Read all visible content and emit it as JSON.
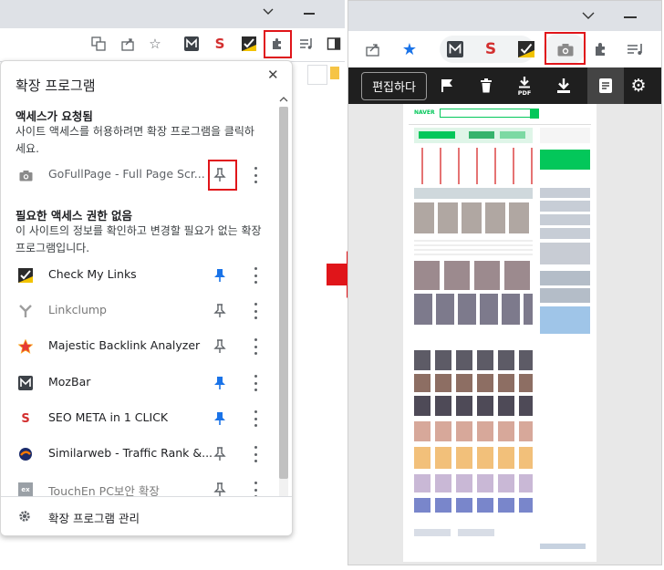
{
  "left": {
    "popup": {
      "title": "확장 프로그램",
      "section1_heading": "액세스가 요청됨",
      "section1_desc": "사이트 액세스를 허용하려면 확장 프로그램을 클릭하세요.",
      "section2_heading": "필요한 액세스 권한 없음",
      "section2_desc": "이 사이트의 정보를 확인하고 변경할 필요가 없는 확장 프로그램입니다.",
      "requested": [
        {
          "name": "GoFullPage - Full Page Scr...",
          "icon": "camera-icon",
          "pinned": false
        }
      ],
      "extensions": [
        {
          "name": "Check My Links",
          "icon": "check-my-links-icon",
          "pinned": true
        },
        {
          "name": "Linkclump",
          "icon": "linkclump-icon",
          "pinned": false
        },
        {
          "name": "Majestic Backlink Analyzer",
          "icon": "majestic-star-icon",
          "pinned": false
        },
        {
          "name": "MozBar",
          "icon": "mozbar-icon",
          "pinned": true
        },
        {
          "name": "SEO META in 1 CLICK",
          "icon": "seo-meta-icon",
          "pinned": true
        },
        {
          "name": "Similarweb - Traffic Rank &...",
          "icon": "similarweb-icon",
          "pinned": false
        },
        {
          "name": "TouchEn PC보안 확장",
          "icon": "touchen-icon",
          "pinned": false
        }
      ],
      "footer_label": "확장 프로그램 관리"
    }
  },
  "right": {
    "gofullpage_toolbar": {
      "edit_label": "편집하다",
      "pdf_label": "PDF"
    },
    "preview": {
      "logo": "NAVER"
    }
  },
  "colors": {
    "highlight_red": "#e0151a",
    "pin_blue": "#1a73e8",
    "gfp_bar": "#1f1f1f",
    "naver_green": "#03c75a"
  }
}
